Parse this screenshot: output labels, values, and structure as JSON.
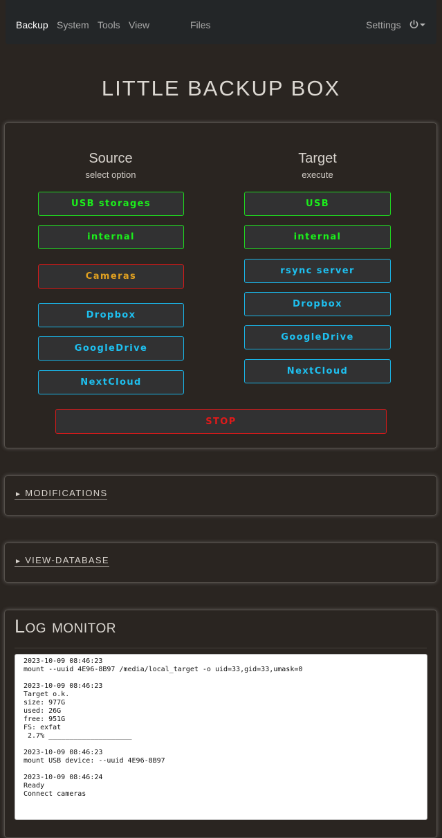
{
  "nav": {
    "items": [
      {
        "label": "Backup",
        "active": true
      },
      {
        "label": "System"
      },
      {
        "label": "Tools"
      },
      {
        "label": "View"
      },
      {
        "label": "Files"
      }
    ],
    "settings": "Settings",
    "power_icon": "power-icon"
  },
  "title": "LITTLE BACKUP BOX",
  "source": {
    "heading": "Source",
    "sub": "select option",
    "buttons": [
      {
        "label": "USB storages",
        "color": "green"
      },
      {
        "label": "internal",
        "color": "green"
      },
      {
        "label": "Cameras",
        "color": "red"
      },
      {
        "label": "Dropbox",
        "color": "blue"
      },
      {
        "label": "GoogleDrive",
        "color": "blue"
      },
      {
        "label": "NextCloud",
        "color": "blue"
      }
    ]
  },
  "target": {
    "heading": "Target",
    "sub": "execute",
    "buttons": [
      {
        "label": "USB",
        "color": "green"
      },
      {
        "label": "internal",
        "color": "green"
      },
      {
        "label": "rsync server",
        "color": "blue"
      },
      {
        "label": "Dropbox",
        "color": "blue"
      },
      {
        "label": "GoogleDrive",
        "color": "blue"
      },
      {
        "label": "NextCloud",
        "color": "blue"
      }
    ]
  },
  "stop_label": "STOP",
  "modifications": "MODIFICATIONS",
  "view_database": "VIEW-DATABASE",
  "log": {
    "title": "Log monitor",
    "entries": [
      [
        "2023-10-09 08:46:23",
        "mount --uuid 4E96-8B97 /media/local_target -o uid=33,gid=33,umask=0"
      ],
      [
        "2023-10-09 08:46:23",
        "Target o.k.",
        "size: 977G",
        "used: 26G",
        "free: 951G",
        "FS: exfat",
        " 2.7% ____________________"
      ],
      [
        "2023-10-09 08:46:23",
        "mount USB device: --uuid 4E96-8B97"
      ],
      [
        "2023-10-09 08:46:24",
        "Ready",
        "Connect cameras"
      ]
    ]
  },
  "colors": {
    "green": "#1bf01b",
    "blue": "#1ec0f0",
    "orange": "#e0a020",
    "red": "#e01a1a",
    "background": "#2a2521"
  }
}
